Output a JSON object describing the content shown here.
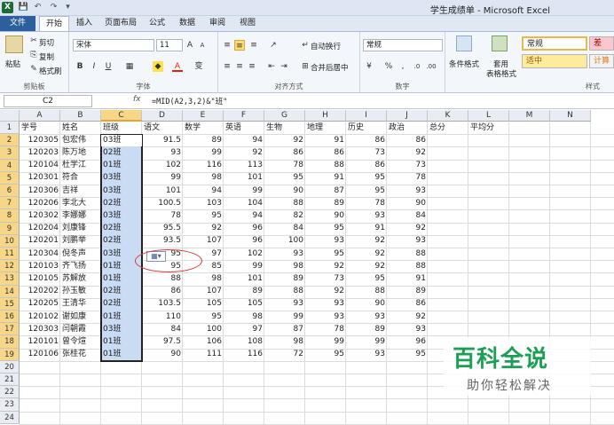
{
  "window": {
    "title": "学生成绩单 - Microsoft Excel"
  },
  "quick_access": [
    "X",
    "💾",
    "↶",
    "↷",
    "▾"
  ],
  "tabs": [
    {
      "label": "文件"
    },
    {
      "label": "开始"
    },
    {
      "label": "插入"
    },
    {
      "label": "页面布局"
    },
    {
      "label": "公式"
    },
    {
      "label": "数据"
    },
    {
      "label": "审阅"
    },
    {
      "label": "视图"
    }
  ],
  "ribbon": {
    "clipboard": {
      "paste": "粘贴",
      "cut": "剪切",
      "copy": "复制",
      "format_painter": "格式刷",
      "label": "剪贴板"
    },
    "font": {
      "name": "宋体",
      "size": "11",
      "label": "字体"
    },
    "alignment": {
      "wrap": "自动换行",
      "merge": "合并后居中",
      "label": "对齐方式"
    },
    "number": {
      "format": "常规",
      "label": "数字"
    },
    "styles": {
      "conditional": "条件格式",
      "table_format": "套用",
      "table_format2": "表格格式",
      "normal": "常规",
      "bad": "差",
      "medium": "适中",
      "calc": "计算",
      "label": "样式"
    }
  },
  "formula_bar": {
    "cell_ref": "C2",
    "fx": "fx",
    "formula": "=MID(A2,3,2)&\"班\""
  },
  "columns": [
    "A",
    "B",
    "C",
    "D",
    "E",
    "F",
    "G",
    "H",
    "I",
    "J",
    "K",
    "L",
    "M",
    "N"
  ],
  "selected_column": "C",
  "headers": [
    "学号",
    "姓名",
    "班级",
    "语文",
    "数学",
    "英语",
    "生物",
    "地理",
    "历史",
    "政治",
    "总分",
    "平均分"
  ],
  "rows": [
    [
      "120305",
      "包宏伟",
      "03班",
      "91.5",
      "89",
      "94",
      "92",
      "91",
      "86",
      "86"
    ],
    [
      "120203",
      "陈万地",
      "02班",
      "93",
      "99",
      "92",
      "86",
      "86",
      "73",
      "92"
    ],
    [
      "120104",
      "杜学江",
      "01班",
      "102",
      "116",
      "113",
      "78",
      "88",
      "86",
      "73"
    ],
    [
      "120301",
      "符合",
      "03班",
      "99",
      "98",
      "101",
      "95",
      "91",
      "95",
      "78"
    ],
    [
      "120306",
      "吉祥",
      "03班",
      "101",
      "94",
      "99",
      "90",
      "87",
      "95",
      "93"
    ],
    [
      "120206",
      "李北大",
      "02班",
      "100.5",
      "103",
      "104",
      "88",
      "89",
      "78",
      "90"
    ],
    [
      "120302",
      "李娜娜",
      "03班",
      "78",
      "95",
      "94",
      "82",
      "90",
      "93",
      "84"
    ],
    [
      "120204",
      "刘康锋",
      "02班",
      "95.5",
      "92",
      "96",
      "84",
      "95",
      "91",
      "92"
    ],
    [
      "120201",
      "刘鹏举",
      "02班",
      "93.5",
      "107",
      "96",
      "100",
      "93",
      "92",
      "93"
    ],
    [
      "120304",
      "倪冬声",
      "03班",
      "95",
      "97",
      "102",
      "93",
      "95",
      "92",
      "88"
    ],
    [
      "120103",
      "齐飞扬",
      "01班",
      "95",
      "85",
      "99",
      "98",
      "92",
      "92",
      "88"
    ],
    [
      "120105",
      "苏解放",
      "01班",
      "88",
      "98",
      "101",
      "89",
      "73",
      "95",
      "91"
    ],
    [
      "120202",
      "孙玉敏",
      "02班",
      "86",
      "107",
      "89",
      "88",
      "92",
      "88",
      "89"
    ],
    [
      "120205",
      "王清华",
      "02班",
      "103.5",
      "105",
      "105",
      "93",
      "93",
      "90",
      "86"
    ],
    [
      "120102",
      "谢如康",
      "01班",
      "110",
      "95",
      "98",
      "99",
      "93",
      "93",
      "92"
    ],
    [
      "120303",
      "闫朝霞",
      "03班",
      "84",
      "100",
      "97",
      "87",
      "78",
      "89",
      "93"
    ],
    [
      "120101",
      "曾令煊",
      "01班",
      "97.5",
      "106",
      "108",
      "98",
      "99",
      "99",
      "96"
    ],
    [
      "120106",
      "张桂花",
      "01班",
      "90",
      "111",
      "116",
      "72",
      "95",
      "93",
      "95"
    ]
  ],
  "row_numbers": [
    "1",
    "2",
    "3",
    "4",
    "5",
    "6",
    "7",
    "8",
    "9",
    "10",
    "11",
    "12",
    "13",
    "14",
    "15",
    "16",
    "17",
    "18",
    "19",
    "20",
    "21",
    "22",
    "23",
    "24"
  ],
  "watermark": {
    "logo": "百科全说",
    "sub": "助你轻松解决"
  }
}
